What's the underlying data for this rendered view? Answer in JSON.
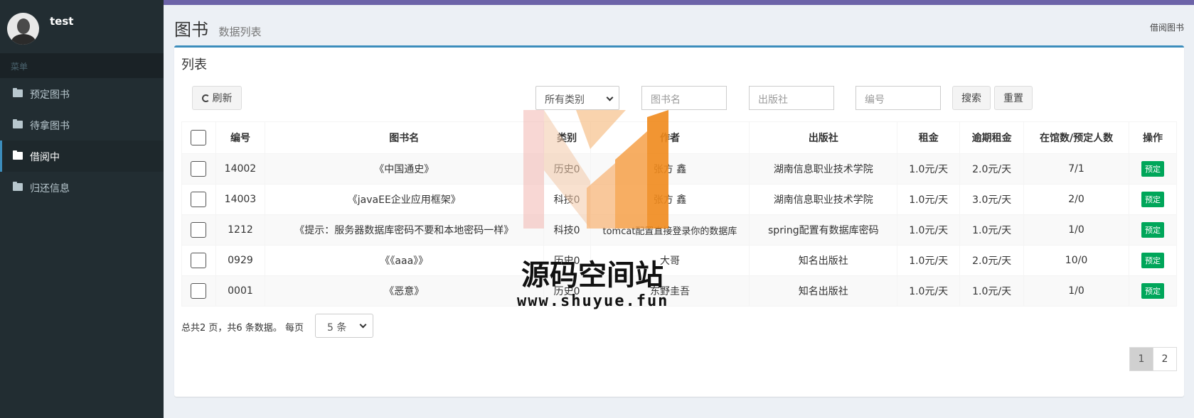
{
  "user": {
    "name": "test"
  },
  "sidebar": {
    "header": "菜单",
    "items": [
      {
        "label": "预定图书",
        "icon": "folder-icon"
      },
      {
        "label": "待拿图书",
        "icon": "folder-icon"
      },
      {
        "label": "借阅中",
        "icon": "folder-icon",
        "active": true
      },
      {
        "label": "归还信息",
        "icon": "folder-icon"
      }
    ]
  },
  "header": {
    "title": "图书",
    "subtitle": "数据列表",
    "breadcrumb": "借阅图书"
  },
  "box": {
    "title": "列表"
  },
  "toolbar": {
    "refresh_label": "刷新",
    "category_select": "所有类别",
    "book_name_placeholder": "图书名",
    "publisher_placeholder": "出版社",
    "code_placeholder": "编号",
    "search_label": "搜索",
    "reset_label": "重置"
  },
  "table": {
    "columns": [
      "编号",
      "图书名",
      "类别",
      "作者",
      "出版社",
      "租金",
      "逾期租金",
      "在馆数/预定人数",
      "操作"
    ],
    "rows": [
      {
        "id": "14002",
        "name": "《中国通史》",
        "category": "历史0",
        "author": "张方 鑫",
        "publisher": "湖南信息职业技术学院",
        "rent": "1.0元/天",
        "overdue": "2.0元/天",
        "stock": "7/1",
        "action": "预定"
      },
      {
        "id": "14003",
        "name": "《javaEE企业应用框架》",
        "category": "科技0",
        "author": "张方 鑫",
        "publisher": "湖南信息职业技术学院",
        "rent": "1.0元/天",
        "overdue": "3.0元/天",
        "stock": "2/0",
        "action": "预定"
      },
      {
        "id": "1212",
        "name": "《提示：服务器数据库密码不要和本地密码一样》",
        "category": "科技0",
        "author": "tomcat配置直接登录你的数据库",
        "publisher": "spring配置有数据库密码",
        "rent": "1.0元/天",
        "overdue": "1.0元/天",
        "stock": "1/0",
        "action": "预定"
      },
      {
        "id": "0929",
        "name": "《《aaa》》",
        "category": "历史0",
        "author": "大哥",
        "publisher": "知名出版社",
        "rent": "1.0元/天",
        "overdue": "2.0元/天",
        "stock": "10/0",
        "action": "预定"
      },
      {
        "id": "0001",
        "name": "《恶意》",
        "category": "历史0",
        "author": "东野圭吾",
        "publisher": "知名出版社",
        "rent": "1.0元/天",
        "overdue": "1.0元/天",
        "stock": "1/0",
        "action": "预定"
      }
    ]
  },
  "pagination": {
    "summary": "总共2 页，共6 条数据。 每页",
    "page_size": "5 条",
    "pages": [
      "1",
      "2"
    ],
    "current": "1"
  },
  "watermark": {
    "title": "源码空间站",
    "url": "www.shuyue.fun"
  },
  "colors": {
    "accent": "#3c8dbc",
    "sidebar": "#222d32",
    "tag": "#00a65a",
    "topbar": "#6c63a8"
  }
}
